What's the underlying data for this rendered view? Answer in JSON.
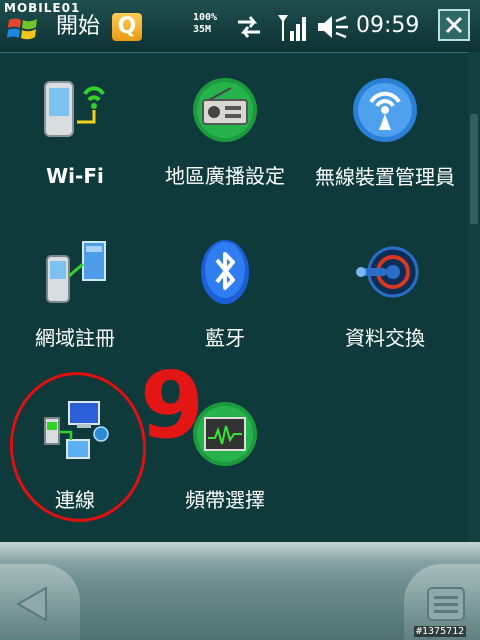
{
  "watermark": {
    "top": "MOBILE01",
    "bottom": "#1375712"
  },
  "status_bar": {
    "start_label": "開始",
    "q_logo": "Q",
    "battery_line1": "100%",
    "battery_line2": "35M",
    "clock": "09:59",
    "icons": [
      "windows-flag-icon",
      "sync-arrows-icon",
      "signal-bars-icon",
      "volume-icon",
      "close-icon"
    ]
  },
  "tiles": [
    {
      "label": "Wi-Fi",
      "icon": "wifi-phone-icon"
    },
    {
      "label": "地區廣播設定",
      "icon": "radio-icon"
    },
    {
      "label": "無線裝置管理員",
      "icon": "wireless-manager-icon"
    },
    {
      "label": "網域註冊",
      "icon": "domain-enroll-icon"
    },
    {
      "label": "藍牙",
      "icon": "bluetooth-icon"
    },
    {
      "label": "資料交換",
      "icon": "beam-icon"
    },
    {
      "label": "連線",
      "icon": "connections-icon"
    },
    {
      "label": "頻帶選擇",
      "icon": "band-select-icon"
    }
  ],
  "annotation": {
    "number": "9",
    "color": "#e01010"
  },
  "colors": {
    "background": "#0f3a3c",
    "accent": "#ffcc55"
  }
}
